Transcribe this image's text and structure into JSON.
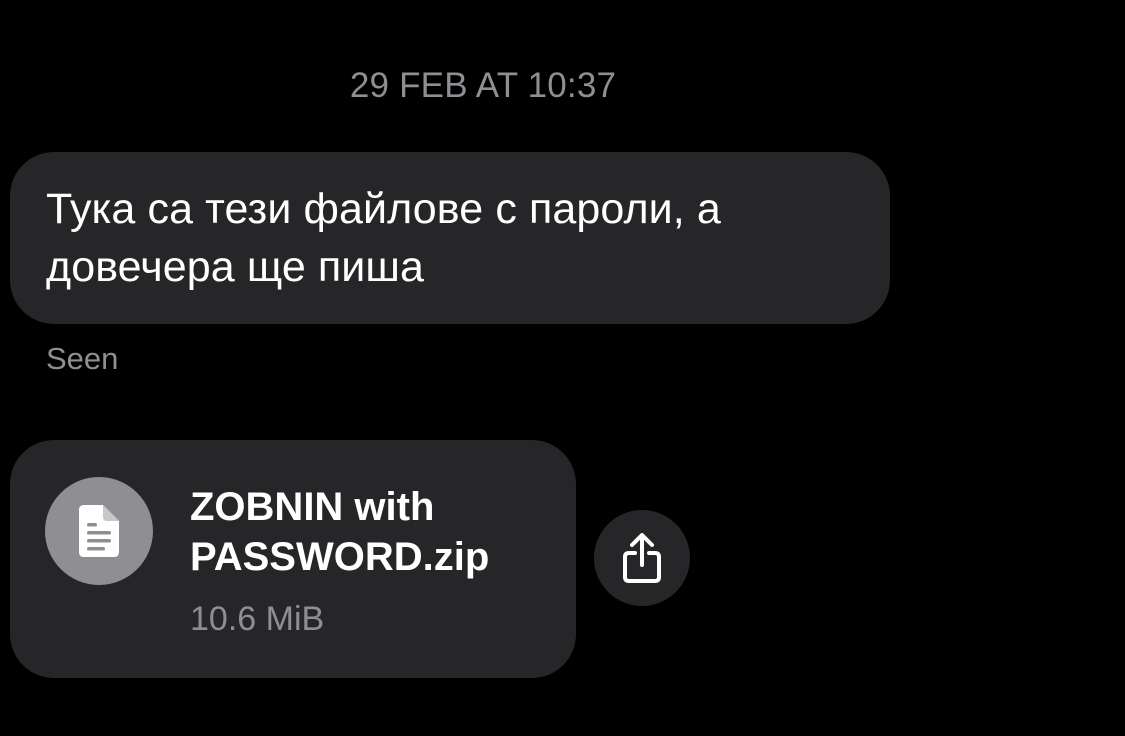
{
  "conversation": {
    "timestamp": "29 FEB AT 10:37",
    "text_message": {
      "line1": "Тука са тези файлове с пароли, а",
      "line2": "довечера ще пиша",
      "status": "Seen"
    },
    "file_message": {
      "icon": "document-icon",
      "name_line1": "ZOBNIN with",
      "name_line2": "PASSWORD.zip",
      "size": "10.6 MiB",
      "share_icon": "share-icon"
    }
  },
  "theme": {
    "background": "#000000",
    "bubble": "#262628",
    "secondary_text": "#8e8e93",
    "primary_text": "#ffffff",
    "file_icon_circle": "#8e8e93"
  }
}
